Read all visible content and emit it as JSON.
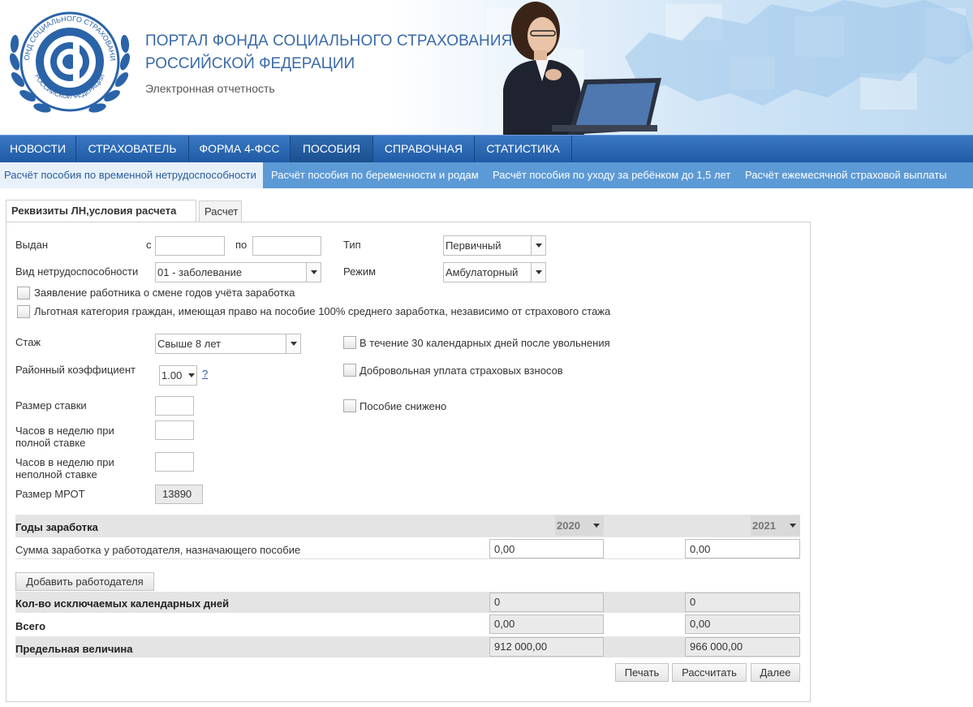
{
  "header": {
    "title_line1": "ПОРТАЛ ФОНДА СОЦИАЛЬНОГО СТРАХОВАНИЯ",
    "title_line2": "РОССИЙСКОЙ ФЕДЕРАЦИИ",
    "subtitle": "Электронная отчетность",
    "logo_ring_top": "ФОНД СОЦИАЛЬНОГО СТРАХОВАНИЯ",
    "logo_ring_bottom": "РОССИЙСКОЙ ФЕДЕРАЦИИ"
  },
  "nav": {
    "items": [
      "НОВОСТИ",
      "СТРАХОВАТЕЛЬ",
      "ФОРМА 4-ФСС",
      "ПОСОБИЯ",
      "СПРАВОЧНАЯ",
      "СТАТИСТИКА"
    ],
    "active": "ПОСОБИЯ"
  },
  "subnav": {
    "items": [
      "Расчёт пособия по временной нетрудоспособности",
      "Расчёт пособия по беременности и родам",
      "Расчёт пособия по уходу за ребёнком до 1,5 лет",
      "Расчёт ежемесячной страховой выплаты"
    ]
  },
  "tabs": [
    "Реквизиты ЛН,условия расчета",
    "Расчет"
  ],
  "form": {
    "issued_label": "Выдан",
    "from_label": "с",
    "to_label": "по",
    "from_value": "",
    "to_value": "",
    "type_label": "Тип",
    "type_value": "Первичный",
    "disability_label": "Вид нетрудоспособности",
    "disability_value": "01 - заболевание",
    "mode_label": "Режим",
    "mode_value": "Амбулаторный",
    "cb_years_change": "Заявление работника о смене годов учёта заработка",
    "cb_privileged": "Льготная категория граждан, имеющая право на пособие 100% среднего заработка, независимо от страхового стажа",
    "experience_label": "Стаж",
    "experience_value": "Свыше 8 лет",
    "cb_30days": "В течение 30 календарных дней после увольнения",
    "regional_label": "Районный коэффициент",
    "regional_value": "1.00",
    "help_link": "?",
    "cb_voluntary": "Добровольная уплата страховых взносов",
    "rate_label": "Размер ставки",
    "rate_value": "",
    "cb_reduced": "Пособие снижено",
    "hours_full_line1": "Часов в неделю при",
    "hours_full_line2": "полной ставке",
    "hours_full_value": "",
    "hours_part_line1": "Часов в неделю при",
    "hours_part_line2": "неполной ставке",
    "hours_part_value": "",
    "mrot_label": "Размер МРОТ",
    "mrot_value": "13890"
  },
  "earnings": {
    "years_label": "Годы заработка",
    "year1": "2020",
    "year2": "2021",
    "sum_label": "Сумма заработка у работодателя, назначающего пособие",
    "sum1": "0,00",
    "sum2": "0,00",
    "add_employer": "Добавить работодателя",
    "excluded_label": "Кол-во исключаемых календарных дней",
    "excluded1": "0",
    "excluded2": "0",
    "total_label": "Всего",
    "total1": "0,00",
    "total2": "0,00",
    "limit_label": "Предельная величина",
    "limit1": "912 000,00",
    "limit2": "966 000,00"
  },
  "buttons": {
    "print": "Печать",
    "calculate": "Рассчитать",
    "next": "Далее"
  }
}
